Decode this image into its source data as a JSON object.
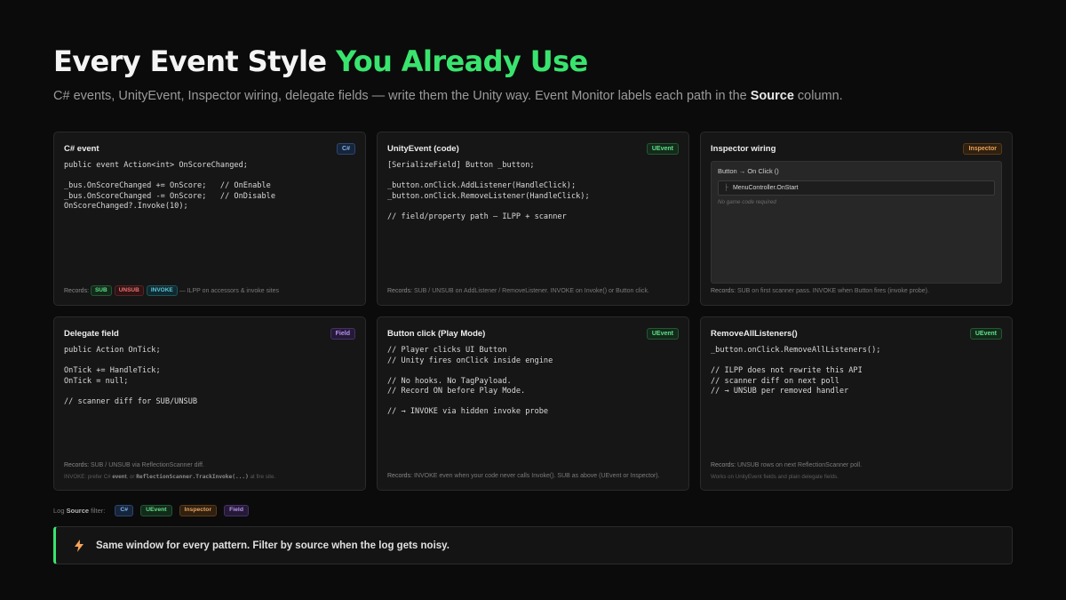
{
  "header": {
    "title_main": "Every Event Style ",
    "title_accent": "You Already Use",
    "subtitle_pre": "C# events, UnityEvent, Inspector wiring, delegate fields — write them the Unity way. Event Monitor labels each path in the ",
    "subtitle_bold": "Source",
    "subtitle_post": " column."
  },
  "colors": {
    "accent": "#39e46e",
    "background": "#0b0b0b",
    "card": "#161616",
    "badge_cs": "#7fb2ee",
    "badge_uevent": "#5ee088",
    "badge_inspector": "#e8a15a",
    "badge_field": "#b793ee"
  },
  "cards": [
    {
      "title": "C# event",
      "badge": "C#",
      "code": [
        "public event Action<int> OnScoreChanged;",
        "",
        "_bus.OnScoreChanged += OnScore;   // OnEnable",
        "_bus.OnScoreChanged -= OnScore;   // OnDisable",
        "OnScoreChanged?.Invoke(10);"
      ],
      "footer_label": "Records:",
      "footer_badges": [
        "SUB",
        "UNSUB",
        "INVOKE"
      ],
      "footer_text": " — ILPP on accessors & invoke sites"
    },
    {
      "title": "UnityEvent (code)",
      "badge": "UEvent",
      "code": [
        "[SerializeField] Button _button;",
        "",
        "_button.onClick.AddListener(HandleClick);",
        "_button.onClick.RemoveListener(HandleClick);",
        "",
        "// field/property path — ILPP + scanner"
      ],
      "footer_label": "Records:",
      "footer_text": " SUB / UNSUB on AddListener / RemoveListener. INVOKE on Invoke() or Button click."
    },
    {
      "title": "Inspector wiring",
      "badge": "Inspector",
      "inspector": {
        "header": "Button → On Click ()",
        "row": "MenuController.OnStart",
        "hint": "No game code required"
      },
      "footer_label": "Records:",
      "footer_text": " SUB on first scanner pass. INVOKE when Button fires (invoke probe)."
    },
    {
      "title": "Delegate field",
      "badge": "Field",
      "code": [
        "public Action OnTick;",
        "",
        "OnTick += HandleTick;",
        "OnTick = null;",
        "",
        "// scanner diff for SUB/UNSUB"
      ],
      "footer_label": "Records:",
      "footer_text": " SUB / UNSUB via ReflectionScanner diff.",
      "note_pre": "INVOKE: prefer C# ",
      "note_bold": "event",
      "note_mid": ", or ",
      "note_mono": "ReflectionScanner.TrackInvoke(...)",
      "note_post": " at fire site."
    },
    {
      "title": "Button click (Play Mode)",
      "badge": "UEvent",
      "code": [
        "// Player clicks UI Button",
        "// Unity fires onClick inside engine",
        "",
        "// No hooks. No TagPayload.",
        "// Record ON before Play Mode.",
        "",
        "// → INVOKE via hidden invoke probe"
      ],
      "footer_label": "Records:",
      "footer_text": " INVOKE even when your code never calls Invoke(). SUB as above (UEvent or Inspector)."
    },
    {
      "title": "RemoveAllListeners()",
      "badge": "UEvent",
      "code": [
        "_button.onClick.RemoveAllListeners();",
        "",
        "// ILPP does not rewrite this API",
        "// scanner diff on next poll",
        "// → UNSUB per removed handler"
      ],
      "footer_label": "Records:",
      "footer_text": " UNSUB rows on next ReflectionScanner poll.",
      "note": "Works on UnityEvent fields and plain delegate fields."
    }
  ],
  "filter": {
    "label_pre": "Log ",
    "label_bold": "Source",
    "label_post": " filter:",
    "options": [
      "C#",
      "UEvent",
      "Inspector",
      "Field"
    ]
  },
  "banner": {
    "icon": "lightning-icon",
    "message": "Same window for every pattern. Filter by source when the log gets noisy."
  }
}
